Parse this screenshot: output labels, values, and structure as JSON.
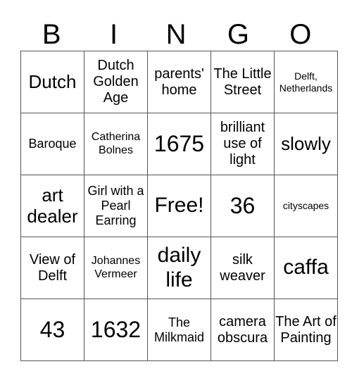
{
  "header": [
    "B",
    "I",
    "N",
    "G",
    "O"
  ],
  "rows": [
    [
      "Dutch",
      "Dutch Golden Age",
      "parents' home",
      "The Little Street",
      "Delft, Netherlands"
    ],
    [
      "Baroque",
      "Catherina Bolnes",
      "1675",
      "brilliant use of light",
      "slowly"
    ],
    [
      "art dealer",
      "Girl with a Pearl Earring",
      "Free!",
      "36",
      "cityscapes"
    ],
    [
      "View of Delft",
      "Johannes Vermeer",
      "daily life",
      "silk weaver",
      "caffa"
    ],
    [
      "43",
      "1632",
      "The Milkmaid",
      "camera obscura",
      "The Art of Painting"
    ]
  ]
}
